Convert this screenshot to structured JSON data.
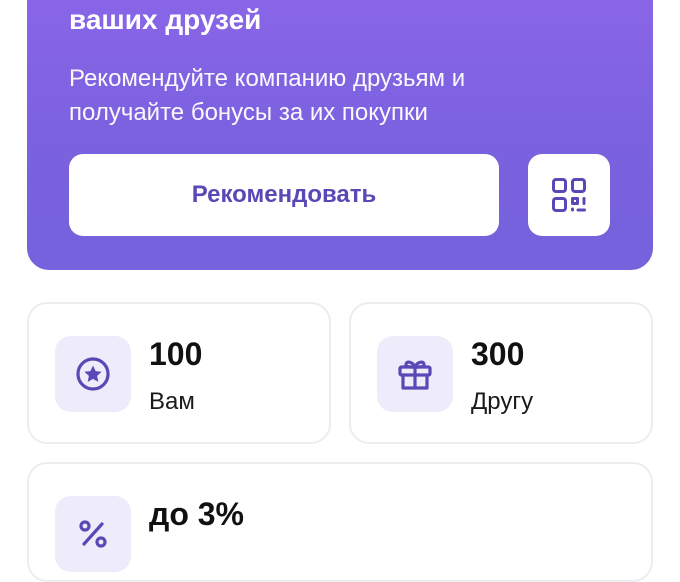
{
  "promo": {
    "title": "ваших друзей",
    "subtitle": "Рекомендуйте компанию друзьям и получайте бонусы за их покупки",
    "recommend_label": "Рекомендовать",
    "qr_icon": "qr-code-icon"
  },
  "bonuses": [
    {
      "value": "100",
      "label": "Вам",
      "icon": "star-badge-icon"
    },
    {
      "value": "300",
      "label": "Другу",
      "icon": "gift-icon"
    },
    {
      "value": "до 3%",
      "label": "",
      "icon": "percent-icon"
    }
  ],
  "colors": {
    "accent": "#7a61de",
    "accent_dark": "#5b48b6",
    "icon_bg": "#eeebfa"
  }
}
